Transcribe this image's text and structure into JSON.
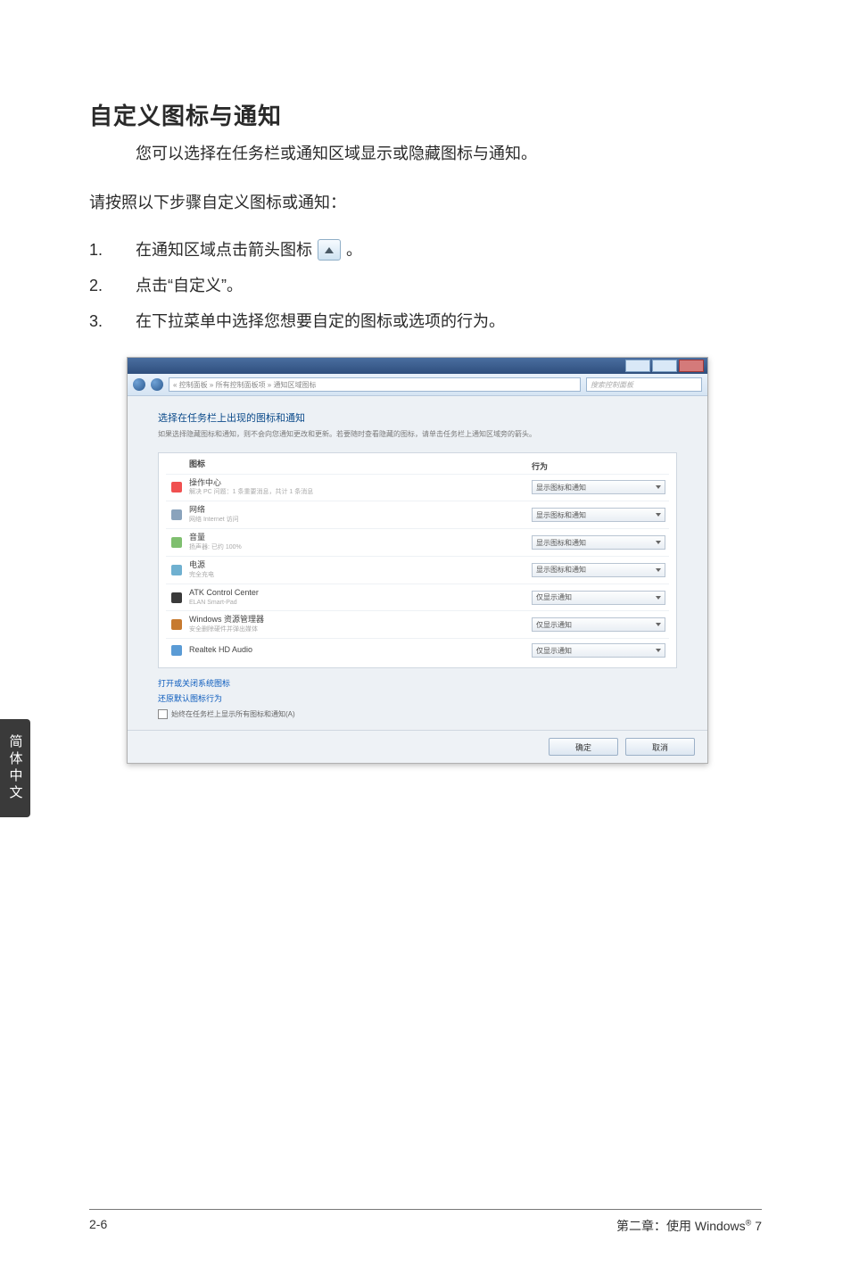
{
  "heading": "自定义图标与通知",
  "intro": "您可以选择在任务栏或通知区域显示或隐藏图标与通知。",
  "follow": "请按照以下步骤自定义图标或通知：",
  "step1_num": "1.",
  "step1_a": "在通知区域点击箭头图标",
  "step1_b": "。",
  "step2_num": "2.",
  "step2": "点击“自定义”。",
  "step3_num": "3.",
  "step3": "在下拉菜单中选择您想要自定的图标或选项的行为。",
  "addrbar": "« 控制面板 » 所有控制面板项 » 通知区域图标",
  "searchph": "搜索控制面板",
  "dlg_h": "选择在任务栏上出现的图标和通知",
  "dlg_sub": "如果选择隐藏图标和通知，则不会向您通知更改和更新。若要随时查看隐藏的图标，请单击任务栏上通知区域旁的箭头。",
  "col1": "图标",
  "col2": "行为",
  "r1_name": "操作中心",
  "r1_sub": "解决 PC 问题：1 条重要消息，共计 1 条消息",
  "r1_sel": "显示图标和通知",
  "r2_name": "网络",
  "r2_sub": "网络 Internet 访问",
  "r2_sel": "显示图标和通知",
  "r3_name": "音量",
  "r3_sub": "扬声器: 已约 100%",
  "r3_sel": "显示图标和通知",
  "r4_name": "电源",
  "r4_sub": "完全充电",
  "r4_sel": "显示图标和通知",
  "r5_name": "ATK Control Center",
  "r5_sub": "ELAN Smart-Pad",
  "r5_sel": "仅显示通知",
  "r6_name": "Windows 资源管理器",
  "r6_sub": "安全删除硬件并弹出媒体",
  "r6_sel": "仅显示通知",
  "r7_name": "Realtek HD Audio",
  "r7_sub": "",
  "r7_sel": "仅显示通知",
  "link1": "打开或关闭系统图标",
  "link2": "还原默认图标行为",
  "checkline": "始终在任务栏上显示所有图标和通知(A)",
  "btn_ok": "确定",
  "btn_cancel": "取消",
  "side_tab": "简体中文",
  "footer_left": "2-6",
  "footer_right_a": "第二章：使用 Windows",
  "footer_right_sup": "®",
  "footer_right_b": " 7"
}
